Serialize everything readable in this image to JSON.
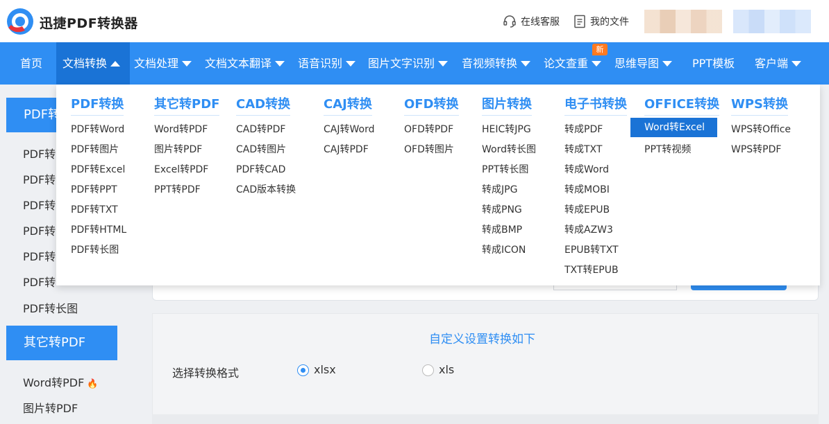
{
  "header": {
    "brand": "迅捷PDF转换器",
    "online_service": "在线客服",
    "my_files": "我的文件"
  },
  "nav": {
    "items": [
      {
        "label": "首页",
        "caret": "none"
      },
      {
        "label": "文档转换",
        "caret": "up",
        "active": true
      },
      {
        "label": "文档处理",
        "caret": "down"
      },
      {
        "label": "文档文本翻译",
        "caret": "down"
      },
      {
        "label": "语音识别",
        "caret": "down"
      },
      {
        "label": "图片文字识别",
        "caret": "down"
      },
      {
        "label": "音视频转换",
        "caret": "down"
      },
      {
        "label": "论文查重",
        "caret": "down"
      },
      {
        "label": "思维导图",
        "caret": "down"
      },
      {
        "label": "PPT模板",
        "caret": "none"
      },
      {
        "label": "客户端",
        "caret": "down"
      }
    ],
    "new_badge": "新"
  },
  "dropdown": {
    "columns": [
      {
        "title": "PDF转换",
        "items": [
          "PDF转Word",
          "PDF转图片",
          "PDF转Excel",
          "PDF转PPT",
          "PDF转TXT",
          "PDF转HTML",
          "PDF转长图"
        ]
      },
      {
        "title": "其它转PDF",
        "items": [
          "Word转PDF",
          "图片转PDF",
          "Excel转PDF",
          "PPT转PDF"
        ]
      },
      {
        "title": "CAD转换",
        "items": [
          "CAD转PDF",
          "CAD转图片",
          "PDF转CAD",
          "CAD版本转换"
        ]
      },
      {
        "title": "CAJ转换",
        "items": [
          "CAJ转Word",
          "CAJ转PDF"
        ]
      },
      {
        "title": "OFD转换",
        "items": [
          "OFD转PDF",
          "OFD转图片"
        ]
      },
      {
        "title": "图片转换",
        "items": [
          "HEIC转JPG",
          "Word转长图",
          "PPT转长图",
          "转成JPG",
          "转成PNG",
          "转成BMP",
          "转成ICON"
        ]
      },
      {
        "title": "电子书转换",
        "items": [
          "转成PDF",
          "转成TXT",
          "转成Word",
          "转成MOBI",
          "转成EPUB",
          "转成AZW3",
          "EPUB转TXT",
          "TXT转EPUB"
        ]
      },
      {
        "title": "OFFICE转换",
        "items": [
          "Word转Excel",
          "PPT转视频"
        ]
      },
      {
        "title": "WPS转换",
        "items": [
          "WPS转Office",
          "WPS转PDF"
        ]
      }
    ],
    "selected": "Word转Excel"
  },
  "sidebar": {
    "group1_title": "PDF转",
    "group1_items": [
      "PDF转",
      "PDF转",
      "PDF转",
      "PDF转",
      "PDF转",
      "PDF转",
      "PDF转长图"
    ],
    "group2_title": "其它转PDF",
    "group2_items": [
      "Word转PDF",
      "图片转PDF"
    ]
  },
  "main": {
    "settings_title": "自定义设置转换如下",
    "format_label": "选择转换格式",
    "options": [
      {
        "label": "xlsx",
        "checked": true
      },
      {
        "label": "xls",
        "checked": false
      }
    ]
  },
  "colors": {
    "primary": "#2f8ef3",
    "active_nav": "#1a73d6",
    "badge": "#ff7a21"
  }
}
